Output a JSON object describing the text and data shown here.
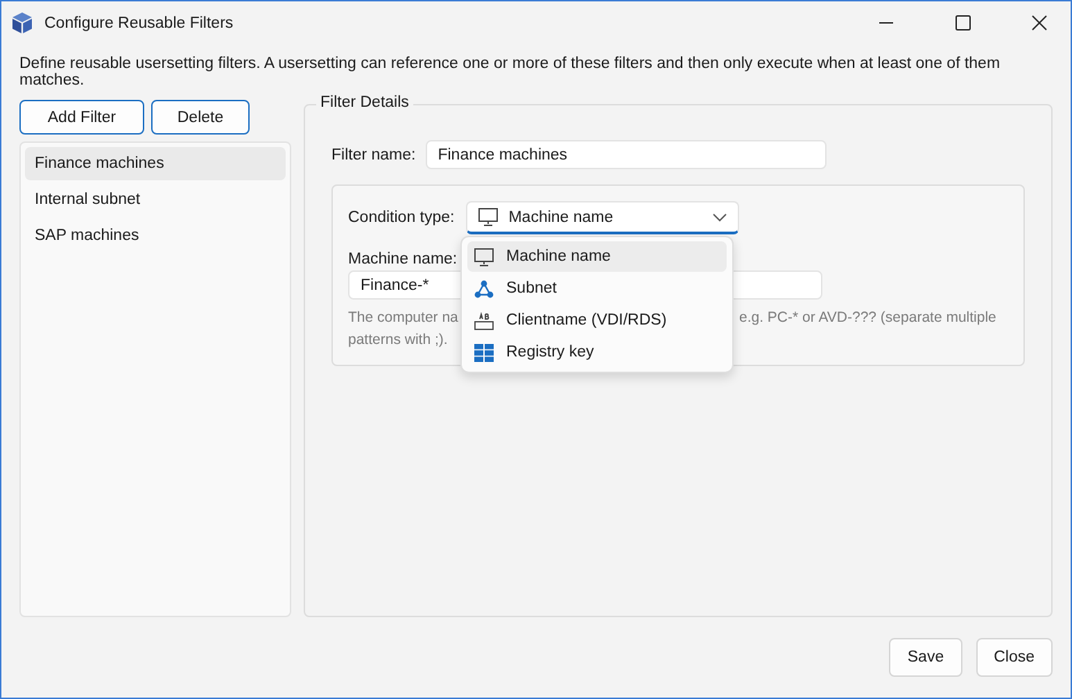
{
  "window": {
    "title": "Configure Reusable Filters"
  },
  "description": "Define reusable usersetting filters. A usersetting can reference one or more of these filters and then only execute when at least one of them matches.",
  "toolbar": [
    "Add Filter",
    "Delete"
  ],
  "filters": [
    {
      "label": "Finance machines",
      "selected": true
    },
    {
      "label": "Internal subnet",
      "selected": false
    },
    {
      "label": "SAP machines",
      "selected": false
    }
  ],
  "details": {
    "title": "Filter Details",
    "filter_name_label": "Filter name:",
    "filter_name": "Finance machines",
    "condition_label": "Condition type:",
    "condition_value": "Machine name",
    "machine_label": "Machine name:",
    "machine_value": "Finance-*",
    "hint_left": "The computer na",
    "hint_right": "e.g. PC-* or AVD-??? (separate multiple",
    "hint_line2": "patterns with ;)."
  },
  "dropdown": [
    {
      "label": "Machine name",
      "kind": "monitor",
      "selected": true
    },
    {
      "label": "Subnet",
      "kind": "network",
      "selected": false
    },
    {
      "label": "Clientname (VDI/RDS)",
      "kind": "text-field",
      "selected": false
    },
    {
      "label": "Registry key",
      "kind": "grid",
      "selected": false
    }
  ],
  "footer": [
    "Save",
    "Close"
  ]
}
